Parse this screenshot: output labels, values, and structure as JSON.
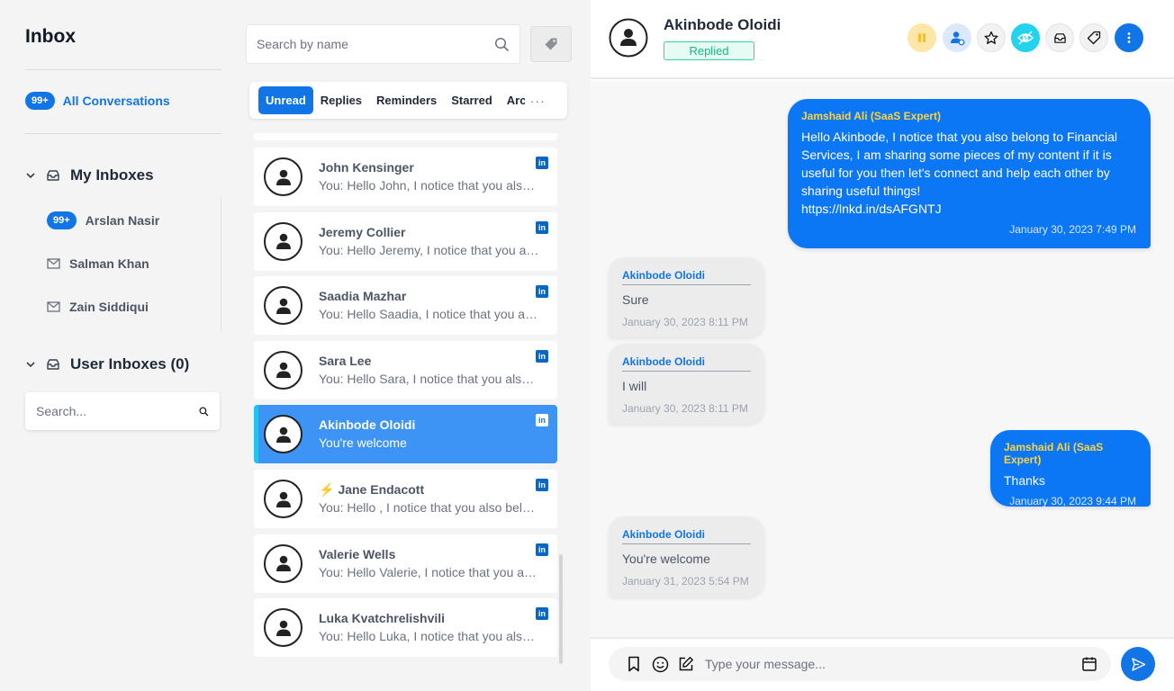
{
  "sidebar": {
    "title": "Inbox",
    "all_conversations": {
      "badge": "99+",
      "label": "All Conversations"
    },
    "my_inboxes": {
      "label": "My Inboxes",
      "items": [
        {
          "badge": "99+",
          "label": "Arslan Nasir"
        },
        {
          "label": "Salman Khan"
        },
        {
          "label": "Zain Siddiqui"
        }
      ]
    },
    "user_inboxes": {
      "label": "User Inboxes (0)"
    },
    "search": {
      "placeholder": "Search..."
    }
  },
  "list": {
    "search_placeholder": "Search by name",
    "tabs": [
      "Unread",
      "Replies",
      "Reminders",
      "Starred",
      "Arch"
    ],
    "tabs_more": "···",
    "conversations": [
      {
        "name": "John Kensinger",
        "preview": "You: Hello John, I notice that you also belong to Financial Services",
        "icon": "linkedin-icon"
      },
      {
        "name": "Jeremy Collier",
        "preview": "You: Hello Jeremy, I notice that you also belong to Financial Services",
        "icon": "linkedin-icon"
      },
      {
        "name": "Saadia Mazhar",
        "preview": "You: Hello Saadia, I notice that you also belong to Financial Services",
        "icon": "linkedin-icon"
      },
      {
        "name": "Sara Lee",
        "preview": "You: Hello Sara, I notice that you also belong to Financial Services",
        "icon": "linkedin-icon"
      },
      {
        "name": "Akinbode Oloidi",
        "preview": "You're welcome",
        "icon": "linkedin-icon",
        "selected": true
      },
      {
        "name": "Jane Endacott",
        "prefix": "⚡",
        "preview": "You: Hello , I notice that you also belong to Financial Services",
        "icon": "linkedin-icon"
      },
      {
        "name": "Valerie Wells",
        "preview": "You: Hello Valerie, I notice that you also belong to Financial Services",
        "icon": "linkedin-icon"
      },
      {
        "name": "Luka Kvatchrelishvili",
        "preview": "You: Hello Luka, I notice that you also belong to Financial Services",
        "icon": "linkedin-icon"
      }
    ]
  },
  "chat": {
    "contact_name": "Akinbode Oloidi",
    "status": "Replied",
    "header_buttons": [
      "pause-icon",
      "assign-user-icon",
      "star-icon",
      "hide-icon",
      "archive-icon",
      "tag-icon",
      "more-vertical-icon"
    ],
    "messages": [
      {
        "direction": "out",
        "sender": "Jamshaid Ali (SaaS Expert)",
        "text": "Hello Akinbode, I notice that you also belong to Financial Services, I am sharing some pieces of my content if it is useful for you then let's connect and help each other by sharing useful things!",
        "link": "https://lnkd.in/dsAFGNTJ",
        "time": "January 30, 2023 7:49 PM"
      },
      {
        "direction": "in",
        "sender": "Akinbode Oloidi",
        "text": "Sure",
        "time": "January 30, 2023 8:11 PM"
      },
      {
        "direction": "in",
        "sender": "Akinbode Oloidi",
        "text": "I will",
        "time": "January 30, 2023 8:11 PM"
      },
      {
        "direction": "out",
        "sender": "Jamshaid Ali (SaaS Expert)",
        "text": "Thanks",
        "time": "January 30, 2023 9:44 PM"
      },
      {
        "direction": "in",
        "sender": "Akinbode Oloidi",
        "text": "You're welcome",
        "time": "January 31, 2023 5:54 PM"
      }
    ],
    "composer": {
      "placeholder": "Type your message..."
    }
  },
  "colors": {
    "accent": "#1175e6",
    "selected_row": "#3d94f5",
    "outgoing_bubble": "#0c77f5",
    "sender_highlight": "#fdd33c",
    "replied": "#10b981",
    "pause": "#fbbf24",
    "hide_active": "#22d3ee"
  }
}
